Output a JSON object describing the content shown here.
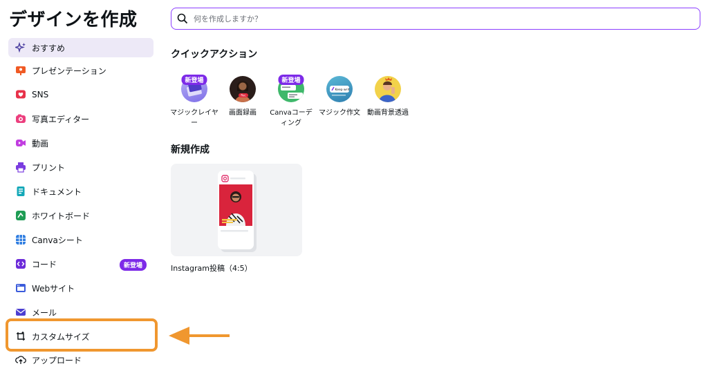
{
  "page_title": "デザインを作成",
  "search": {
    "placeholder": "何を作成しますか？"
  },
  "sidebar": {
    "items": [
      {
        "label": "おすすめ",
        "icon": "sparkle-icon",
        "active": true
      },
      {
        "label": "プレゼンテーション",
        "icon": "presentation-icon"
      },
      {
        "label": "SNS",
        "icon": "heart-icon"
      },
      {
        "label": "写真エディター",
        "icon": "camera-icon"
      },
      {
        "label": "動画",
        "icon": "video-icon"
      },
      {
        "label": "プリント",
        "icon": "printer-icon"
      },
      {
        "label": "ドキュメント",
        "icon": "document-icon"
      },
      {
        "label": "ホワイトボード",
        "icon": "whiteboard-icon"
      },
      {
        "label": "Canvaシート",
        "icon": "sheet-icon"
      },
      {
        "label": "コード",
        "icon": "code-icon",
        "badge": "新登場"
      },
      {
        "label": "Webサイト",
        "icon": "website-icon"
      },
      {
        "label": "メール",
        "icon": "mail-icon"
      },
      {
        "label": "カスタムサイズ",
        "icon": "custom-size-icon"
      },
      {
        "label": "アップロード",
        "icon": "upload-icon"
      }
    ]
  },
  "quick_actions": {
    "title": "クイックアクション",
    "items": [
      {
        "label": "マジックレイヤー",
        "badge": "新登場",
        "icon": "magic-layer-icon"
      },
      {
        "label": "画面録画",
        "icon": "screen-record-icon"
      },
      {
        "label": "Canvaコーディング",
        "badge": "新登場",
        "icon": "canva-code-icon"
      },
      {
        "label": "マジック作文",
        "icon": "magic-write-icon"
      },
      {
        "label": "動画背景透過",
        "icon": "video-bg-remover-icon"
      }
    ],
    "thumb_texts": {
      "record_badge": "Rec",
      "write_chip": "Keep writ"
    }
  },
  "new_design": {
    "title": "新規作成",
    "items": [
      {
        "label": "Instagram投稿（4:5）",
        "icon": "instagram-icon"
      }
    ]
  },
  "colors": {
    "accent": "#8b3dff",
    "badge": "#7d2ae8",
    "highlight": "#f0972f",
    "active_bg": "#ede9f7"
  }
}
